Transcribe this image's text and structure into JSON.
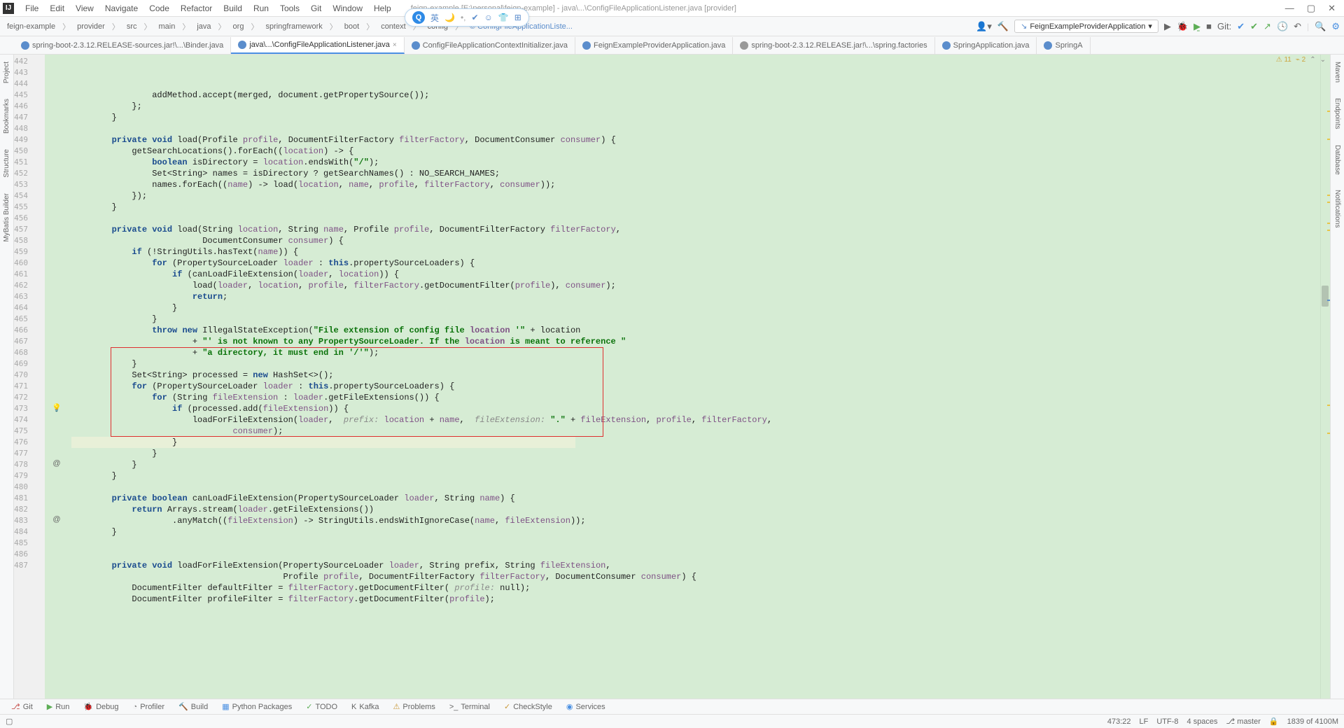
{
  "window": {
    "title": "feign-example [E:\\personal\\feign-example] - java\\...\\ConfigFileApplicationListener.java [provider]"
  },
  "menu": [
    "File",
    "Edit",
    "View",
    "Navigate",
    "Code",
    "Refactor",
    "Build",
    "Run",
    "Tools",
    "Git",
    "Window",
    "Help"
  ],
  "breadcrumb": [
    "feign-example",
    "provider",
    "src",
    "main",
    "java",
    "org",
    "springframework",
    "boot",
    "context",
    "config",
    "ConfigFileApplicationListe..."
  ],
  "run_config": "FeignExampleProviderApplication",
  "git_label": "Git:",
  "tabs": [
    {
      "label": "spring-boot-2.3.12.RELEASE-sources.jar!\\...\\Binder.java",
      "icon": "java",
      "active": false
    },
    {
      "label": "java\\...\\ConfigFileApplicationListener.java",
      "icon": "java",
      "active": true,
      "dirty": true
    },
    {
      "label": "ConfigFileApplicationContextInitializer.java",
      "icon": "java",
      "active": false
    },
    {
      "label": "FeignExampleProviderApplication.java",
      "icon": "java",
      "active": false
    },
    {
      "label": "spring-boot-2.3.12.RELEASE.jar!\\...\\spring.factories",
      "icon": "file",
      "active": false
    },
    {
      "label": "SpringApplication.java",
      "icon": "java",
      "active": false
    },
    {
      "label": "SpringA",
      "icon": "java",
      "active": false
    }
  ],
  "left_tools": [
    "Project",
    "Bookmarks",
    "Structure",
    "MyBatis Builder"
  ],
  "right_tools": [
    "Maven",
    "Endpoints",
    "Database",
    "Notifications"
  ],
  "warnings": {
    "w": "11",
    "a": "2"
  },
  "floating": {
    "lang": "英",
    "moon": "🌙"
  },
  "first_line": 442,
  "code": [
    "                addMethod.accept(merged, document.getPropertySource());",
    "            };",
    "        }",
    "",
    "        private void load(Profile profile, DocumentFilterFactory filterFactory, DocumentConsumer consumer) {",
    "            getSearchLocations().forEach((location) -> {",
    "                boolean isDirectory = location.endsWith(\"/\");",
    "                Set<String> names = isDirectory ? getSearchNames() : NO_SEARCH_NAMES;",
    "                names.forEach((name) -> load(location, name, profile, filterFactory, consumer));",
    "            });",
    "        }",
    "",
    "        private void load(String location, String name, Profile profile, DocumentFilterFactory filterFactory,",
    "                          DocumentConsumer consumer) {",
    "            if (!StringUtils.hasText(name)) {",
    "                for (PropertySourceLoader loader : this.propertySourceLoaders) {",
    "                    if (canLoadFileExtension(loader, location)) {",
    "                        load(loader, location, profile, filterFactory.getDocumentFilter(profile), consumer);",
    "                        return;",
    "                    }",
    "                }",
    "                throw new IllegalStateException(\"File extension of config file location '\" + location",
    "                        + \"' is not known to any PropertySourceLoader. If the location is meant to reference \"",
    "                        + \"a directory, it must end in '/'\");",
    "            }",
    "            Set<String> processed = new HashSet<>();",
    "            for (PropertySourceLoader loader : this.propertySourceLoaders) {",
    "                for (String fileExtension : loader.getFileExtensions()) {",
    "                    if (processed.add(fileExtension)) {",
    "                        loadForFileExtension(loader,  prefix: location + name,  fileExtension: \".\" + fileExtension, profile, filterFactory,",
    "                                consumer);",
    "                    }",
    "                }",
    "            }",
    "        }",
    "",
    "        private boolean canLoadFileExtension(PropertySourceLoader loader, String name) {",
    "            return Arrays.stream(loader.getFileExtensions())",
    "                    .anyMatch((fileExtension) -> StringUtils.endsWithIgnoreCase(name, fileExtension));",
    "        }",
    "",
    "",
    "        private void loadForFileExtension(PropertySourceLoader loader, String prefix, String fileExtension,",
    "                                          Profile profile, DocumentFilterFactory filterFactory, DocumentConsumer consumer) {",
    "            DocumentFilter defaultFilter = filterFactory.getDocumentFilter( profile: null);",
    "            DocumentFilter profileFilter = filterFactory.getDocumentFilter(profile);"
  ],
  "bottom_tabs": [
    {
      "icon": "git",
      "ch": "⎇",
      "label": "Git"
    },
    {
      "icon": "play",
      "ch": "▶",
      "label": "Run"
    },
    {
      "icon": "bug",
      "ch": "🐞",
      "label": "Debug"
    },
    {
      "icon": "prof",
      "ch": "◔",
      "label": "Profiler"
    },
    {
      "icon": "build",
      "ch": "🔨",
      "label": "Build"
    },
    {
      "icon": "py",
      "ch": "▦",
      "label": "Python Packages"
    },
    {
      "icon": "todo",
      "ch": "✓",
      "label": "TODO"
    },
    {
      "icon": "kafka",
      "ch": "K",
      "label": "Kafka"
    },
    {
      "icon": "problem",
      "ch": "⚠",
      "label": "Problems"
    },
    {
      "icon": "term",
      "ch": ">_",
      "label": "Terminal"
    },
    {
      "icon": "check",
      "ch": "✓",
      "label": "CheckStyle"
    },
    {
      "icon": "serv",
      "ch": "◉",
      "label": "Services"
    }
  ],
  "status": {
    "pos": "473:22",
    "le": "LF",
    "enc": "UTF-8",
    "indent": "4 spaces",
    "branch": "master",
    "mem": "1839 of 4100M"
  }
}
